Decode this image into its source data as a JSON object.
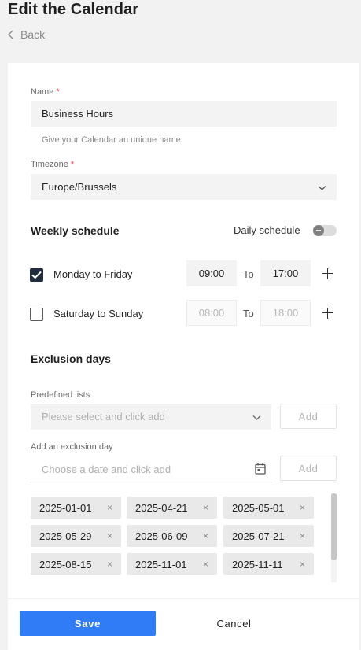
{
  "header": {
    "title": "Edit the Calendar",
    "back_label": "Back"
  },
  "name_field": {
    "label": "Name",
    "required_mark": "*",
    "value": "Business Hours",
    "hint": "Give your Calendar an unique name"
  },
  "timezone_field": {
    "label": "Timezone",
    "required_mark": "*",
    "value": "Europe/Brussels"
  },
  "weekly": {
    "title": "Weekly schedule",
    "daily_label": "Daily schedule",
    "daily_enabled": false,
    "to_label": "To",
    "rows": [
      {
        "label": "Monday to Friday",
        "checked": true,
        "from": "09:00",
        "to": "17:00"
      },
      {
        "label": "Saturday to Sunday",
        "checked": false,
        "from": "08:00",
        "to": "18:00"
      }
    ]
  },
  "exclusion": {
    "title": "Exclusion days",
    "predefined_label": "Predefined lists",
    "predefined_placeholder": "Please select and click add",
    "add_label": "Add",
    "day_label": "Add an exclusion day",
    "day_placeholder": "Choose a date and click add",
    "remove_glyph": "×",
    "days": [
      "2025-01-01",
      "2025-04-21",
      "2025-05-01",
      "2025-05-29",
      "2025-06-09",
      "2025-07-21",
      "2025-08-15",
      "2025-11-01",
      "2025-11-11"
    ]
  },
  "footer": {
    "save_label": "Save",
    "cancel_label": "Cancel"
  },
  "colors": {
    "primary": "#2f7cf6",
    "required": "#e0383e",
    "checkbox_checked": "#1f2d3d"
  },
  "icons": [
    "chevron-left-icon",
    "chevron-down-icon",
    "check-icon",
    "plus-icon",
    "calendar-icon",
    "close-icon",
    "toggle-icon"
  ]
}
